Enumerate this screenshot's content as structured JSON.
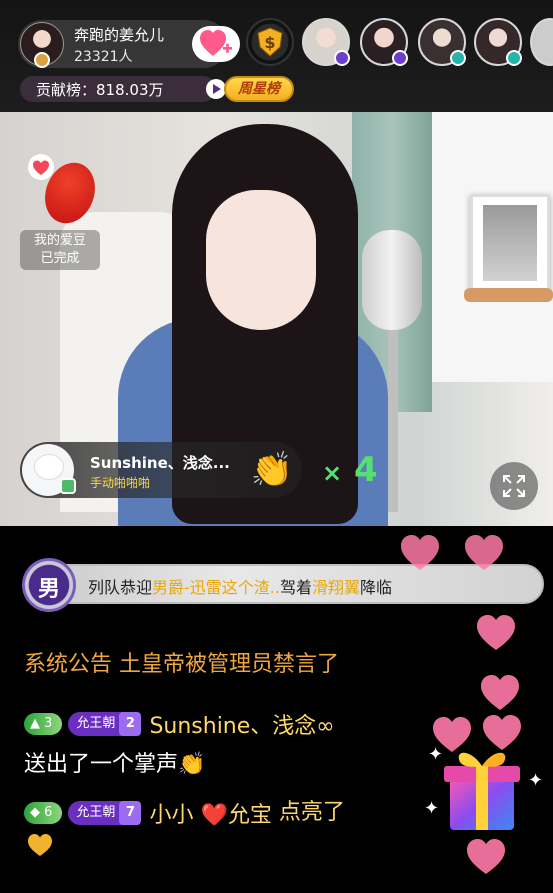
{
  "header": {
    "host_name": "奔跑的姜允儿",
    "fan_count": "23321人",
    "contrib_label": "贡献榜：818.03万",
    "weekly_star": "周星榜"
  },
  "video": {
    "task_label_line1": "我的爱豆",
    "task_label_line2": "已完成",
    "gift_user": "Sunshine、浅念...",
    "gift_desc": "手动啪啪啪",
    "gift_count_symbol": "×",
    "gift_count": "4"
  },
  "chat": {
    "entry_badge": "男",
    "entry_prefix": "列队恭迎",
    "entry_rank": "男爵",
    "entry_user": "-迅雷这个渣..",
    "entry_mid": "驾着",
    "entry_vehicle": "滑翔翼",
    "entry_suffix": "降临",
    "system_title": "系统公告",
    "system_body": "土皇帝被管理员禁言了",
    "messages": [
      {
        "level": "3",
        "fan_club": "允王朝",
        "fan_level": "2",
        "user": "Sunshine、浅念∞",
        "text": "送出了一个掌声",
        "emoji": "👏"
      },
      {
        "level": "6",
        "fan_club": "允王朝",
        "fan_level": "7",
        "user": "小小",
        "user_suffix": "允宝",
        "text": "点亮了"
      }
    ]
  },
  "colors": {
    "accent_gold": "#ffd84a",
    "heart_pink": "#ff7aa8",
    "fan_purple": "#6a2fc0",
    "system_orange": "#f0a640"
  },
  "icons": [
    "follow-heart-icon",
    "rank-shield-icon",
    "arrow-right-icon",
    "fullscreen-icon",
    "clap-icon",
    "gift-box-icon",
    "heart-icon"
  ]
}
